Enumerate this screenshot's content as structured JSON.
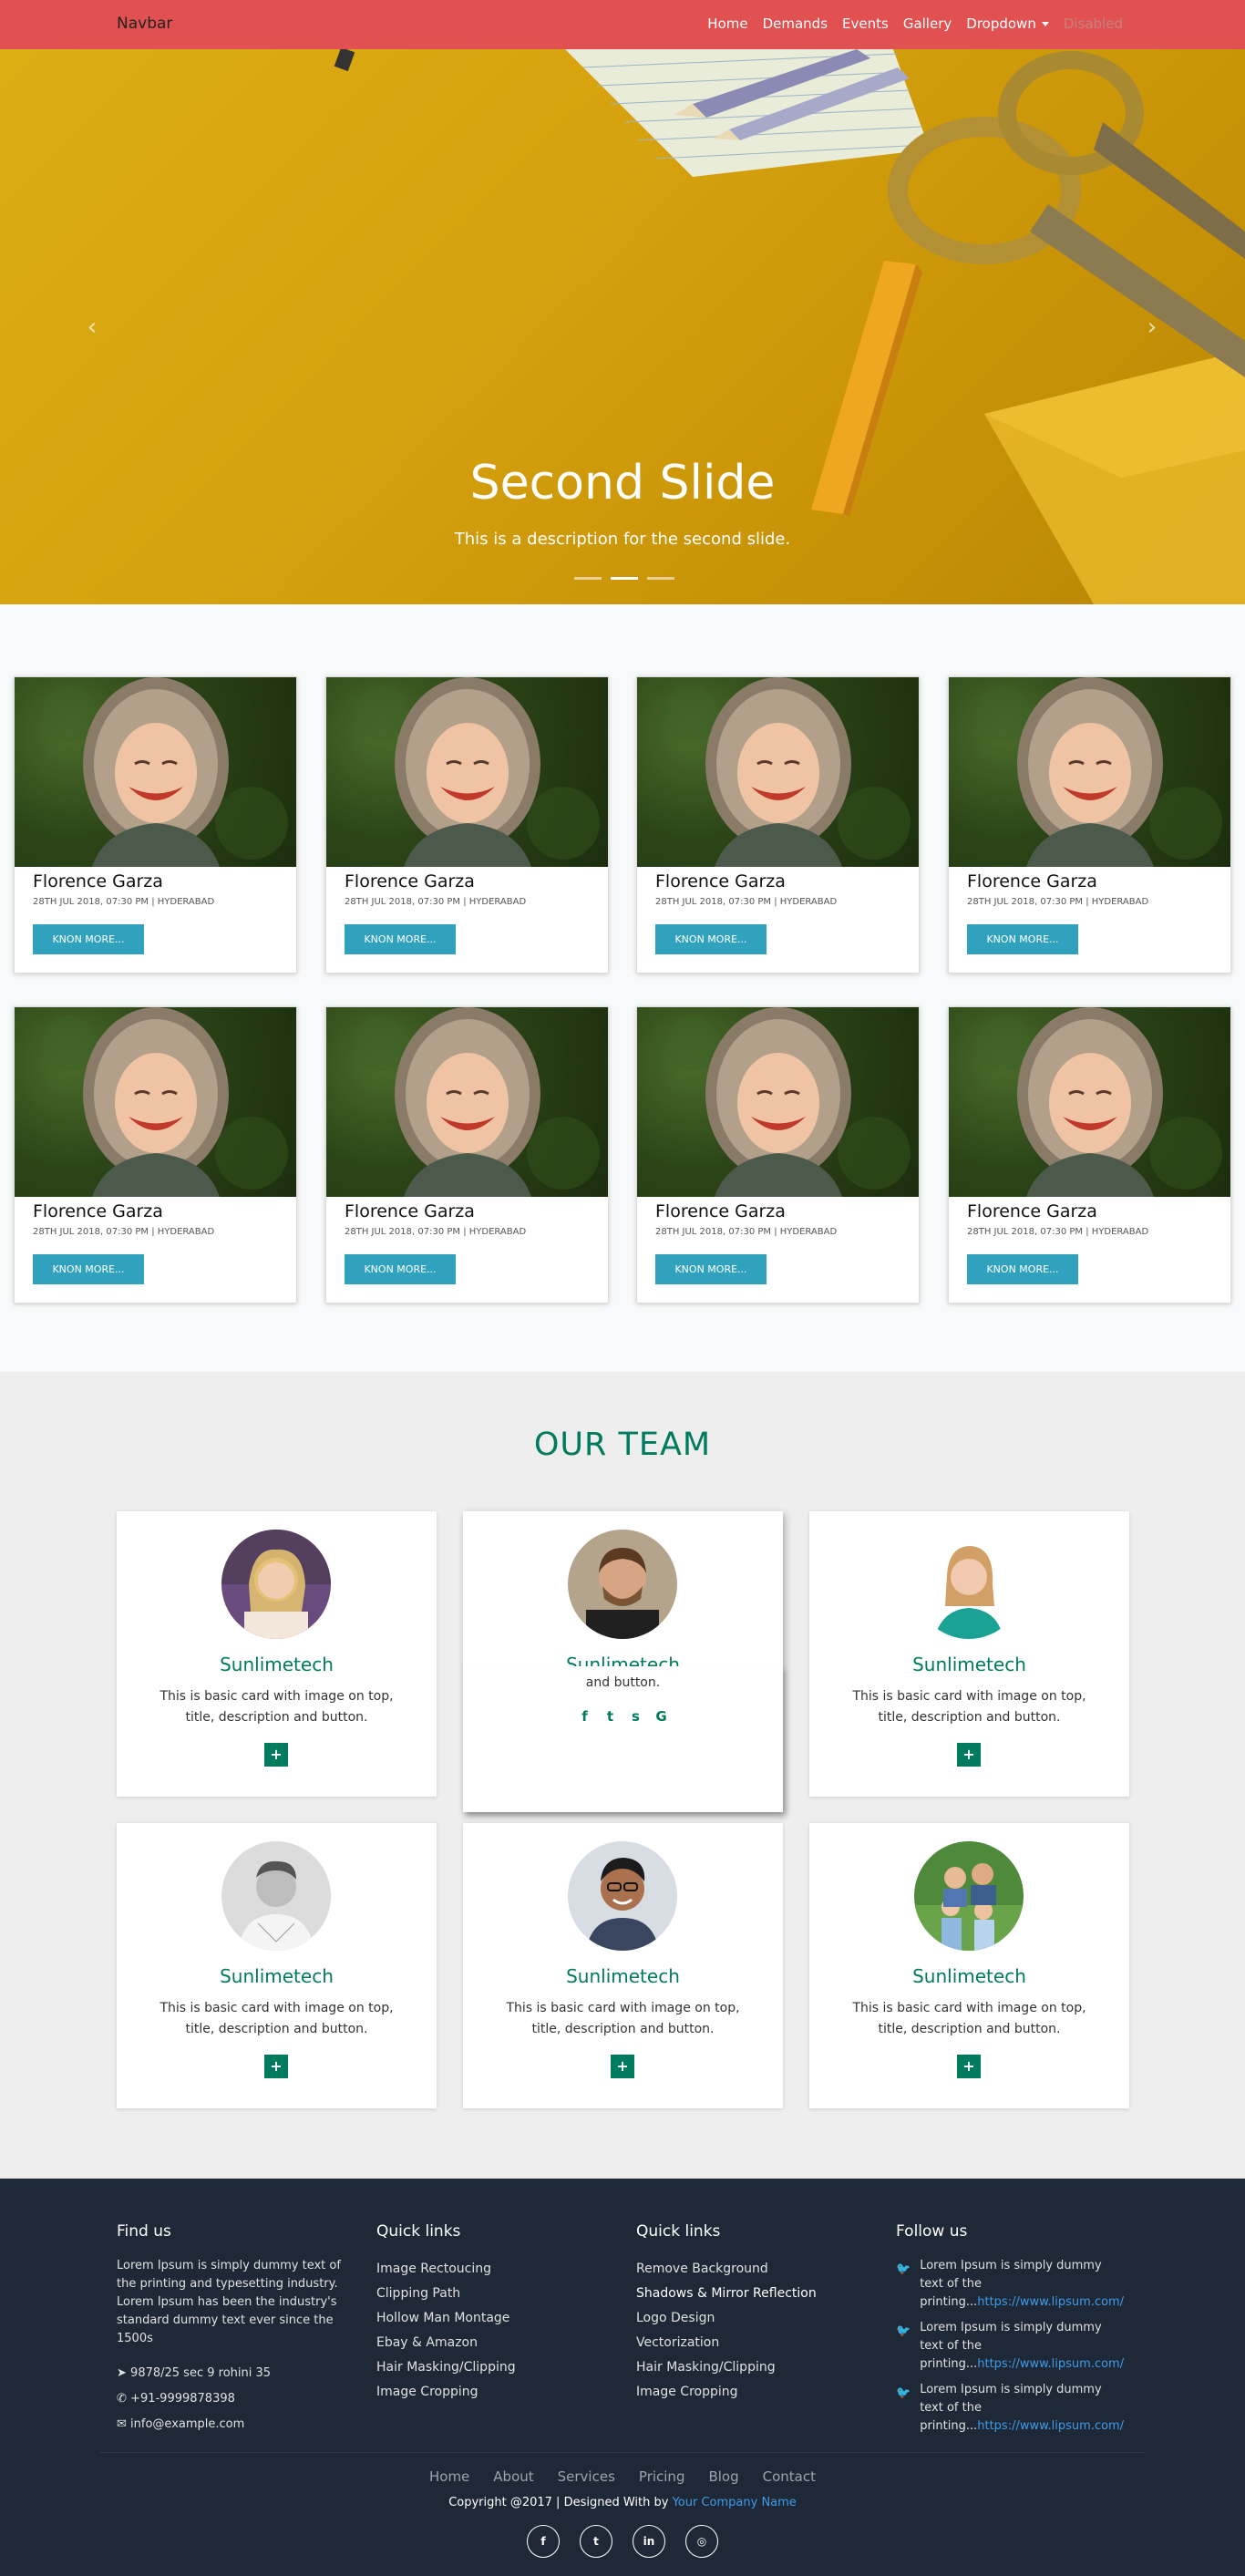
{
  "navbar": {
    "brand": "Navbar",
    "links": [
      "Home",
      "Demands",
      "Events",
      "Gallery",
      "Dropdown",
      "Disabled"
    ]
  },
  "carousel": {
    "title": "Second Slide",
    "description": "This is a description for the second slide.",
    "slide_count": 3,
    "active_index": 1,
    "prev_icon": "chevron-left-icon",
    "next_icon": "chevron-right-icon"
  },
  "events": {
    "cards": [
      {
        "name": "Florence Garza",
        "meta": "28TH JUL 2018, 07:30 PM | HYDERABAD",
        "button": "KNON MORE..."
      },
      {
        "name": "Florence Garza",
        "meta": "28TH JUL 2018, 07:30 PM | HYDERABAD",
        "button": "KNON MORE..."
      },
      {
        "name": "Florence Garza",
        "meta": "28TH JUL 2018, 07:30 PM | HYDERABAD",
        "button": "KNON MORE..."
      },
      {
        "name": "Florence Garza",
        "meta": "28TH JUL 2018, 07:30 PM | HYDERABAD",
        "button": "KNON MORE..."
      },
      {
        "name": "Florence Garza",
        "meta": "28TH JUL 2018, 07:30 PM | HYDERABAD",
        "button": "KNON MORE..."
      },
      {
        "name": "Florence Garza",
        "meta": "28TH JUL 2018, 07:30 PM | HYDERABAD",
        "button": "KNON MORE..."
      },
      {
        "name": "Florence Garza",
        "meta": "28TH JUL 2018, 07:30 PM | HYDERABAD",
        "button": "KNON MORE..."
      },
      {
        "name": "Florence Garza",
        "meta": "28TH JUL 2018, 07:30 PM | HYDERABAD",
        "button": "KNON MORE..."
      }
    ]
  },
  "team": {
    "title": "OUR TEAM",
    "members": [
      {
        "name": "Sunlimetech",
        "desc": "This is basic card with image on top, title, description and button.",
        "button": "+"
      },
      {
        "name": "Sunlimetech",
        "desc_tail": "and button.",
        "social": [
          "facebook-icon",
          "twitter-icon",
          "skype-icon",
          "google-icon"
        ]
      },
      {
        "name": "Sunlimetech",
        "desc": "This is basic card with image on top, title, description and button.",
        "button": "+"
      },
      {
        "name": "Sunlimetech",
        "desc": "This is basic card with image on top, title, description and button.",
        "button": "+"
      },
      {
        "name": "Sunlimetech",
        "desc": "This is basic card with image on top, title, description and button.",
        "button": "+"
      },
      {
        "name": "Sunlimetech",
        "desc": "This is basic card with image on top, title, description and button.",
        "button": "+"
      }
    ]
  },
  "footer": {
    "find_us": {
      "heading": "Find us",
      "text": "Lorem Ipsum is simply dummy text of the printing and typesetting industry. Lorem Ipsum has been the industry's standard dummy text ever since the 1500s",
      "address": "9878/25 sec 9 rohini 35",
      "phone": "+91-9999878398",
      "email": "info@example.com"
    },
    "quick_links_1": {
      "heading": "Quick links",
      "items": [
        "Image Rectoucing",
        "Clipping Path",
        "Hollow Man Montage",
        "Ebay & Amazon",
        "Hair Masking/Clipping",
        "Image Cropping"
      ]
    },
    "quick_links_2": {
      "heading": "Quick links",
      "items": [
        "Remove Background",
        "Shadows & Mirror Reflection",
        "Logo Design",
        "Vectorization",
        "Hair Masking/Clipping",
        "Image Cropping"
      ]
    },
    "follow_us": {
      "heading": "Follow us",
      "tweets": [
        {
          "text": "Lorem Ipsum is simply dummy text of the printing...",
          "link": "https://www.lipsum.com/"
        },
        {
          "text": "Lorem Ipsum is simply dummy text of the printing...",
          "link": "https://www.lipsum.com/"
        },
        {
          "text": "Lorem Ipsum is simply dummy text of the printing...",
          "link": "https://www.lipsum.com/"
        }
      ]
    },
    "nav": [
      "Home",
      "About",
      "Services",
      "Pricing",
      "Blog",
      "Contact"
    ],
    "copyright": "Copyright @2017 | Designed With by",
    "company": "Your Company Name",
    "social": [
      "facebook-icon",
      "twitter-icon",
      "linkedin-icon",
      "instagram-icon"
    ]
  },
  "colors": {
    "navbar": "#e25151",
    "hero": "#d6a20e",
    "button": "#31a2bd",
    "team_accent": "#007b5e",
    "footer": "#1e2836",
    "link": "#3d9be9"
  }
}
